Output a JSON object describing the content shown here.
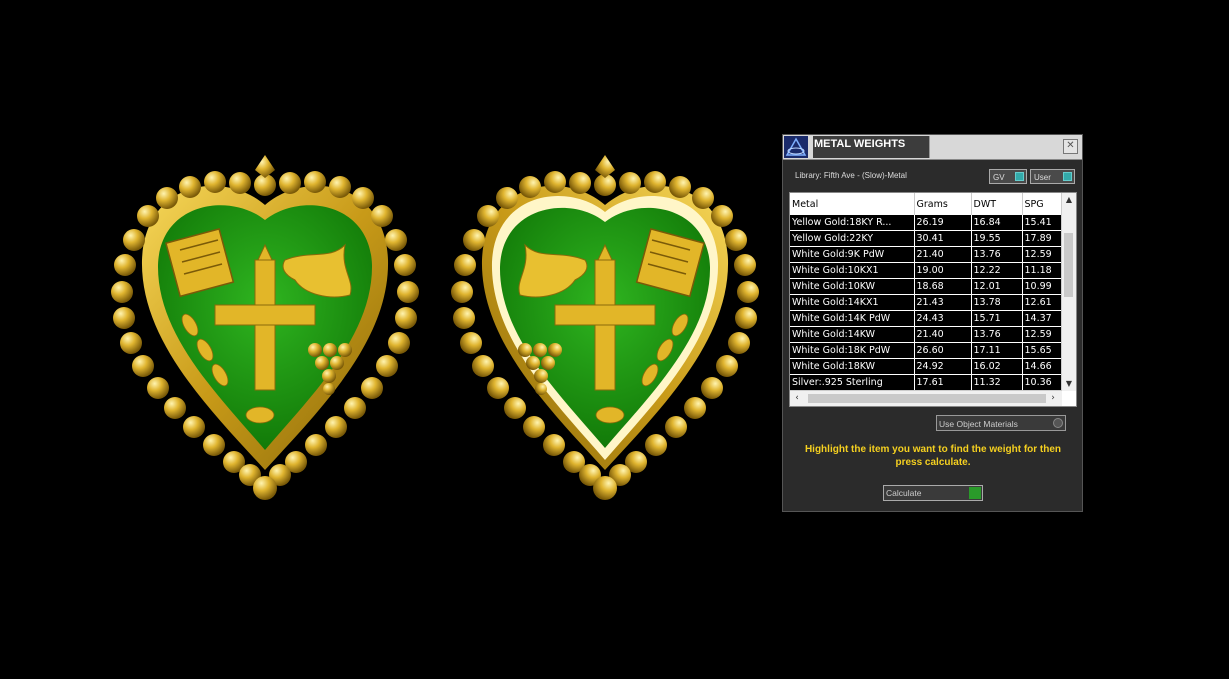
{
  "panel": {
    "title": "METAL WEIGHTS",
    "close_label": "✕",
    "library": "Library: Fifth Ave - (Slow)-Metal",
    "toggle_gv": "GV",
    "toggle_user": "User",
    "columns": [
      "Metal",
      "Grams",
      "DWT",
      "SPG"
    ],
    "rows": [
      [
        "Yellow Gold:18KY R...",
        "26.19",
        "16.84",
        "15.41"
      ],
      [
        "Yellow Gold:22KY",
        "30.41",
        "19.55",
        "17.89"
      ],
      [
        "White Gold:9K PdW",
        "21.40",
        "13.76",
        "12.59"
      ],
      [
        "White Gold:10KX1",
        "19.00",
        "12.22",
        "11.18"
      ],
      [
        "White Gold:10KW",
        "18.68",
        "12.01",
        "10.99"
      ],
      [
        "White Gold:14KX1",
        "21.43",
        "13.78",
        "12.61"
      ],
      [
        "White Gold:14K PdW",
        "24.43",
        "15.71",
        "14.37"
      ],
      [
        "White Gold:14KW",
        "21.40",
        "13.76",
        "12.59"
      ],
      [
        "White Gold:18K PdW",
        "26.60",
        "17.11",
        "15.65"
      ],
      [
        "White Gold:18KW",
        "24.92",
        "16.02",
        "14.66"
      ],
      [
        "Silver:.925 Sterling",
        "17.61",
        "11.32",
        "10.36"
      ]
    ],
    "use_materials": "Use Object Materials",
    "hint": "Highlight the item you want to find the weight for then press calculate.",
    "calculate": "Calculate"
  },
  "colors": {
    "gold": "#d4a820",
    "enamel_green": "#1f9a12",
    "hint_yellow": "#f5d020"
  }
}
